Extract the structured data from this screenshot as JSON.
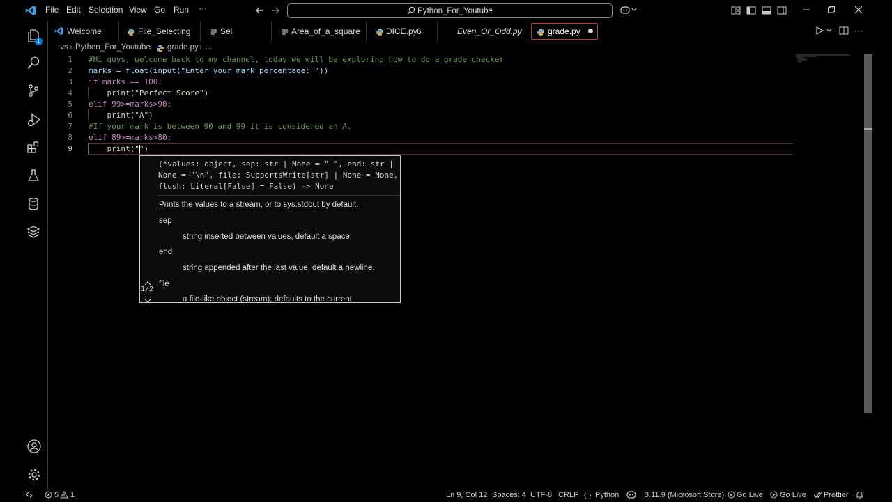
{
  "menu": [
    "File",
    "Edit",
    "Selection",
    "View",
    "Go",
    "Run",
    "···"
  ],
  "search": {
    "label": "Python_For_Youtube"
  },
  "activity": {
    "explorer_badge": "1"
  },
  "tabs": [
    {
      "label": "Welcome",
      "icon": "vscode-icon",
      "italic": false
    },
    {
      "label": "File_Selecting",
      "icon": "python-file-icon",
      "italic": false
    },
    {
      "label": "Sel",
      "icon": "text-file-icon",
      "italic": false
    },
    {
      "label": "Area_of_a_square",
      "icon": "text-file-icon",
      "italic": false
    },
    {
      "label": "DICE.py",
      "icon": "python-file-icon",
      "italic": false,
      "badge": "6"
    },
    {
      "label": "Even_Or_Odd.py",
      "icon": "none",
      "italic": true
    },
    {
      "label": "grade.py",
      "icon": "python-file-icon",
      "italic": false,
      "dirty": true
    }
  ],
  "breadcrumb": [
    ".vs",
    "Python_For_Youtube",
    "grade.py",
    "..."
  ],
  "line_numbers": [
    "1",
    "2",
    "3",
    "4",
    "5",
    "6",
    "7",
    "8",
    "9"
  ],
  "code": [
    "#Hi guys, welcome back to my channel, today we will be exploring how to do a grade checker",
    "marks = float(input(\"Enter your mark percentage: \"))",
    "if marks == 100:",
    "    print(\"Perfect Score\")",
    "elif 99>=marks>90:",
    "    print(\"A\")",
    "#If your mark is between 90 and 99 it is considered an A.",
    "elif 89>=marks>80:",
    "    print(\"\")"
  ],
  "hover": {
    "signature": "(*values: object, sep: str | None = \" \", end: str | None = \"\\n\", file: SupportsWrite[str] | None = None, flush: Literal[False] = False) -> None",
    "description": "Prints the values to a stream, or to sys.stdout by default.",
    "params": [
      {
        "name": "sep",
        "desc": "string inserted between values, default a space."
      },
      {
        "name": "end",
        "desc": "string appended after the last value, default a newline."
      },
      {
        "name": "file",
        "desc": "a file-like object (stream); defaults to the current"
      }
    ],
    "counter": "1/2"
  },
  "status": {
    "problems_errors": "5",
    "problems_warnings": "1",
    "position": "Ln 9, Col 12",
    "spaces": "Spaces: 4",
    "encoding": "UTF-8",
    "eol": "CRLF",
    "language": "Python",
    "interpreter": "3.11.9 (Microsoft Store)",
    "golive1": "Go Live",
    "golive2": "Go Live",
    "prettier": "Prettier"
  },
  "colors": {
    "accent": "#0078d4",
    "keyword": "#c586c0",
    "string": "#ce9178",
    "comment": "#6a9955"
  }
}
